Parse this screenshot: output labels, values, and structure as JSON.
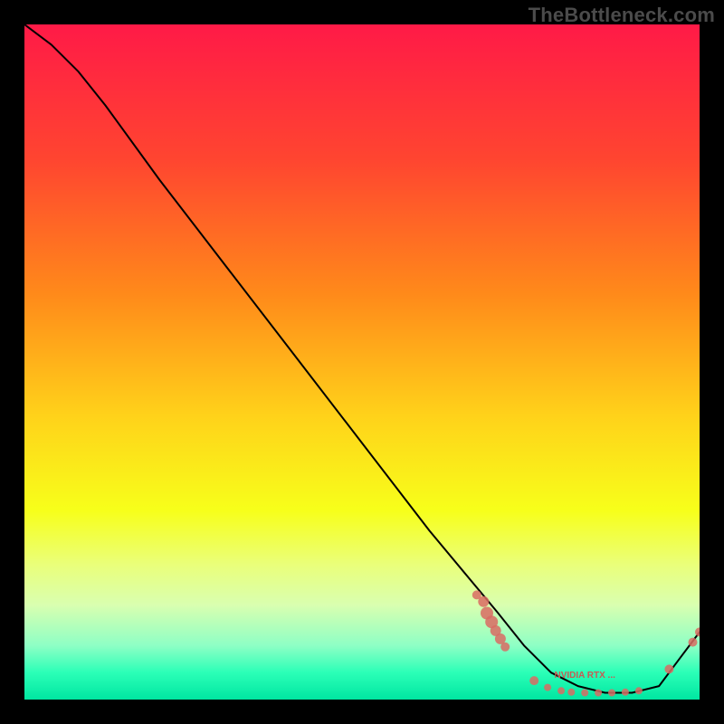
{
  "watermark": "TheBottleneck.com",
  "chart_data": {
    "type": "line",
    "title": "",
    "xlabel": "",
    "ylabel": "",
    "xlim": [
      0,
      100
    ],
    "ylim": [
      0,
      100
    ],
    "grid": false,
    "legend": false,
    "gradient_stops": [
      {
        "offset": 0.0,
        "color": "#ff1a47"
      },
      {
        "offset": 0.2,
        "color": "#ff4530"
      },
      {
        "offset": 0.4,
        "color": "#ff8a1a"
      },
      {
        "offset": 0.58,
        "color": "#ffd21a"
      },
      {
        "offset": 0.72,
        "color": "#f7ff1a"
      },
      {
        "offset": 0.8,
        "color": "#eaff7a"
      },
      {
        "offset": 0.86,
        "color": "#d9ffb0"
      },
      {
        "offset": 0.92,
        "color": "#8effc5"
      },
      {
        "offset": 0.96,
        "color": "#2bffb7"
      },
      {
        "offset": 1.0,
        "color": "#00e6a1"
      }
    ],
    "series": [
      {
        "name": "bottleneck-curve",
        "x": [
          0,
          4,
          8,
          12,
          20,
          30,
          40,
          50,
          60,
          65,
          70,
          74,
          78,
          82,
          86,
          90,
          94,
          97,
          100
        ],
        "y": [
          100,
          97,
          93,
          88,
          77,
          64,
          51,
          38,
          25,
          19,
          13,
          8,
          4,
          2,
          1,
          1,
          2,
          6,
          10
        ]
      }
    ],
    "scatter_points": {
      "name": "datapoints",
      "color": "#d96b63",
      "points": [
        {
          "x": 67.0,
          "y": 15.5,
          "r": 5
        },
        {
          "x": 68.0,
          "y": 14.5,
          "r": 6
        },
        {
          "x": 68.5,
          "y": 12.8,
          "r": 7
        },
        {
          "x": 69.2,
          "y": 11.5,
          "r": 7
        },
        {
          "x": 69.8,
          "y": 10.2,
          "r": 6
        },
        {
          "x": 70.5,
          "y": 9.0,
          "r": 6
        },
        {
          "x": 71.2,
          "y": 7.8,
          "r": 5
        },
        {
          "x": 75.5,
          "y": 2.8,
          "r": 5
        },
        {
          "x": 77.5,
          "y": 1.8,
          "r": 4
        },
        {
          "x": 79.5,
          "y": 1.3,
          "r": 4
        },
        {
          "x": 81.0,
          "y": 1.1,
          "r": 4
        },
        {
          "x": 83.0,
          "y": 1.0,
          "r": 4
        },
        {
          "x": 85.0,
          "y": 1.0,
          "r": 4
        },
        {
          "x": 87.0,
          "y": 1.0,
          "r": 4
        },
        {
          "x": 89.0,
          "y": 1.1,
          "r": 4
        },
        {
          "x": 91.0,
          "y": 1.3,
          "r": 4
        },
        {
          "x": 95.5,
          "y": 4.5,
          "r": 5
        },
        {
          "x": 99.0,
          "y": 8.5,
          "r": 5
        },
        {
          "x": 100.0,
          "y": 10.0,
          "r": 5
        }
      ]
    },
    "annotation": {
      "text": "NVIDIA RTX ...",
      "x": 83,
      "y": 3.2,
      "color": "#c75b54"
    }
  }
}
